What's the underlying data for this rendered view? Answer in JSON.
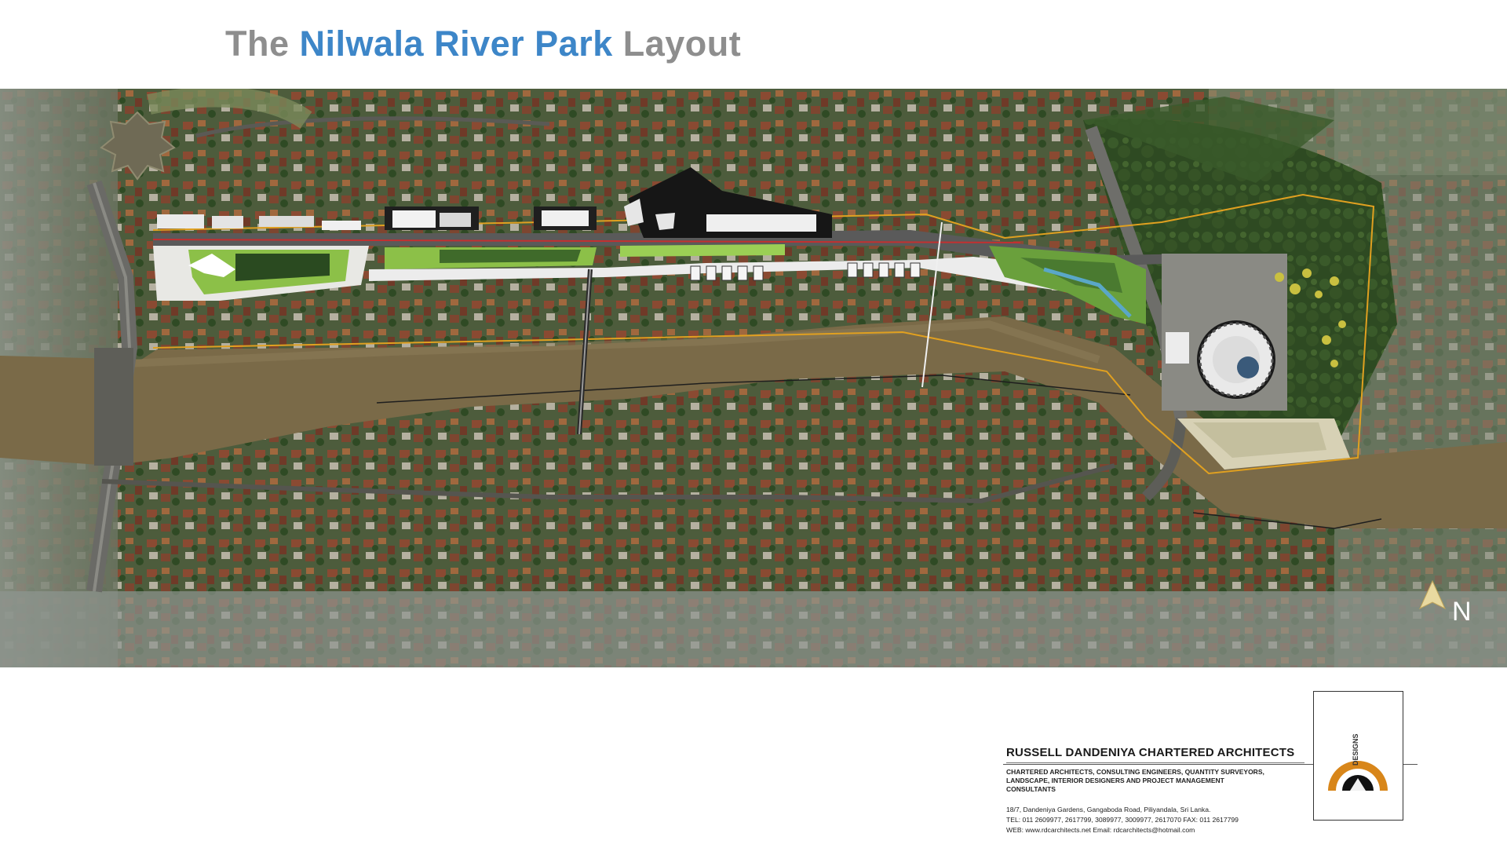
{
  "title": {
    "prefix": "The ",
    "highlight": "Nilwala River Park",
    "suffix": " Layout",
    "colors": {
      "gray": "#8e8e8e",
      "blue": "#3d86c8"
    }
  },
  "map": {
    "north_label": "N",
    "colors": {
      "river": "#7a6a48",
      "vegetation": "#3f5a2e",
      "road": "#5a5a5a",
      "park_green": "#7fb04a",
      "boundary": "#e0a020"
    }
  },
  "firm": {
    "name": "RUSSELL DANDENIYA CHARTERED ARCHITECTS",
    "services": "CHARTERED ARCHITECTS, CONSULTING ENGINEERS, QUANTITY SURVEYORS, LANDSCAPE, INTERIOR DESIGNERS AND PROJECT MANAGEMENT CONSULTANTS",
    "address": "18/7, Dandeniya Gardens, Gangaboda Road, Piliyandala, Sri Lanka.",
    "tel": "TEL: 011 2609977, 2617799, 3089977, 3009977, 2617070 FAX: 011 2617799",
    "web": "WEB: www.rdcarchitects.net Email: rdcarchitects@hotmail.com"
  },
  "logo": {
    "text": "DESIGNS"
  }
}
